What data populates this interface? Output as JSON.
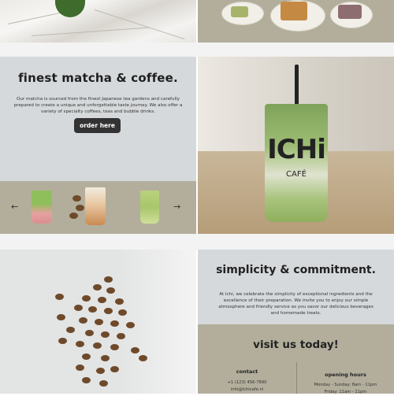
{
  "matcha": {
    "title": "finest matcha & coffee.",
    "body": "Our matcha is sourced from the finest Japanese tea gardens and carefully prepared to create a unique and unforgettable taste journey. We also offer a variety of specialty coffees, teas and bubble drinks.",
    "button": "order here",
    "prev_arrow": "←",
    "next_arrow": "→"
  },
  "hero_cup": {
    "logo": "ICHi",
    "sub": "CAFÉ"
  },
  "simplicity": {
    "title": "simplicity & commitment.",
    "body": "At Ichi, we celebrate the simplicity of exceptional ingredients and the excellence of their preparation. We invite you to enjoy our simple atmosphere and friendly service as you savor our delicious beverages and homemade treats."
  },
  "visit": {
    "title": "visit us today!",
    "contact": {
      "heading": "contact",
      "phone": "+1 (123) 456-7890",
      "email": "info@ichicafe.nl"
    },
    "hours": {
      "heading": "opening hours",
      "line1": "Monday - Sunday: 8am - 11pm",
      "line2": "Friday: 11am - 11pm"
    }
  },
  "colors": {
    "sage": "#b3ae9c",
    "mist": "#d6d9db",
    "button": "#333333",
    "matcha_green": "#7fa25a"
  }
}
